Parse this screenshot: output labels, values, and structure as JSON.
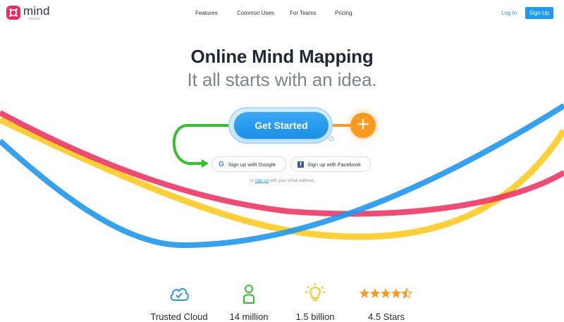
{
  "brand": {
    "name": "mind",
    "sub": "meister",
    "color": "#ee2a5c"
  },
  "nav": {
    "items": [
      "Features",
      "Common Uses",
      "For Teams",
      "Pricing"
    ]
  },
  "auth": {
    "login_label": "Log In",
    "signup_label": "Sign Up"
  },
  "hero": {
    "title": "Online Mind Mapping",
    "subtitle": "It all starts with an idea."
  },
  "cta": {
    "label": "Get Started",
    "add_icon": "plus-icon"
  },
  "social": {
    "google_label": "Sign up with Google",
    "facebook_label": "Sign up with Facebook",
    "email_prefix": "or",
    "email_link": "sign up",
    "email_suffix": "with your email address"
  },
  "features": [
    {
      "icon": "cloud-check-icon",
      "label": "Trusted Cloud"
    },
    {
      "icon": "user-icon",
      "label": "14 million"
    },
    {
      "icon": "lightbulb-icon",
      "label": "1.5 billion"
    },
    {
      "icon": "stars-icon",
      "label": "4.5 Stars",
      "rating": 4.5
    }
  ],
  "colors": {
    "accent": "#1f9af0",
    "cta_orange": "#ff9a1f",
    "connector_green": "#33c12f",
    "wave_yellow": "#ffcc2b",
    "wave_pink": "#ee2a5c",
    "wave_blue": "#1e97ef"
  }
}
